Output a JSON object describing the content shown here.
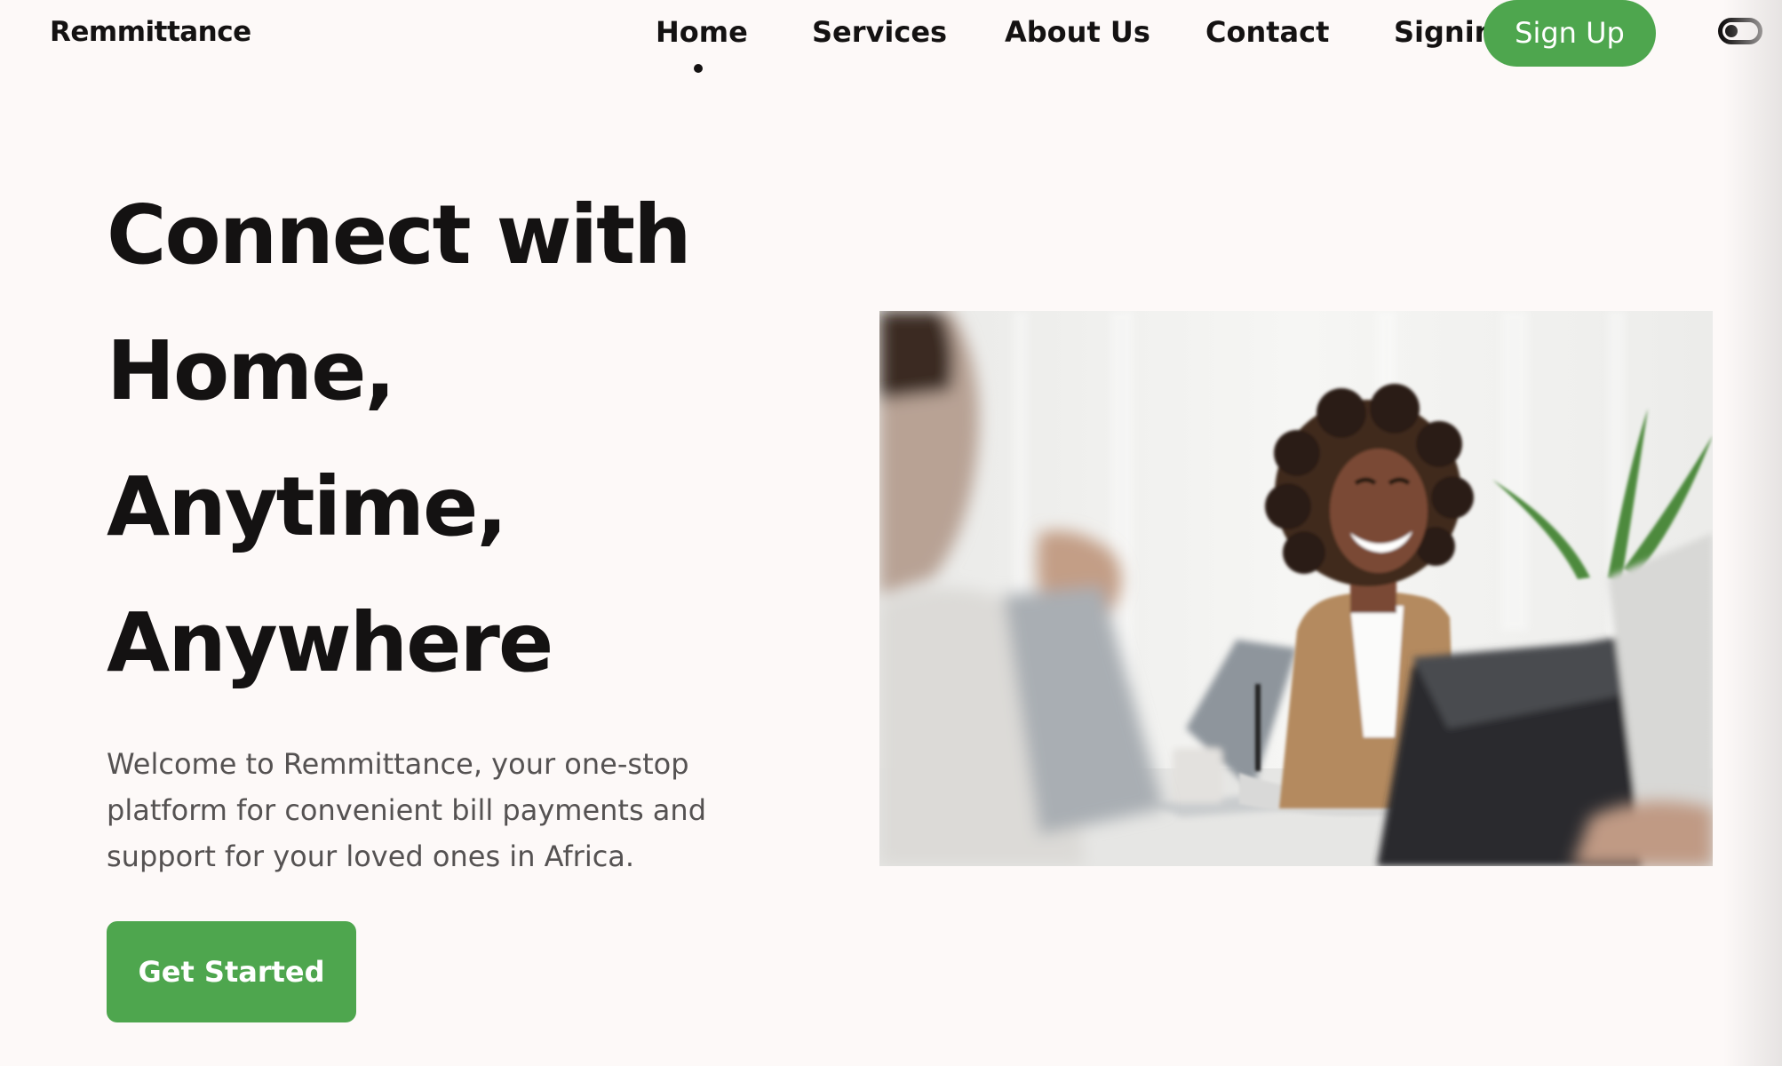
{
  "nav": {
    "brand": "Remmittance",
    "links": [
      "Home",
      "Services",
      "About Us",
      "Contact",
      "Signin"
    ],
    "active": "Home",
    "signup_label": "Sign Up",
    "theme_toggle_icon": "toggle-icon"
  },
  "hero": {
    "title_lines": [
      "Connect with",
      "Home,",
      "Anytime,",
      "Anywhere"
    ],
    "description": "Welcome to Remmittance, your one-stop platform for convenient bill payments and support for your loved ones in Africa.",
    "cta_label": "Get Started"
  },
  "colors": {
    "accent": "#4ea64e",
    "background": "#fdf9f8",
    "text": "#141212",
    "muted_text": "#555252"
  }
}
